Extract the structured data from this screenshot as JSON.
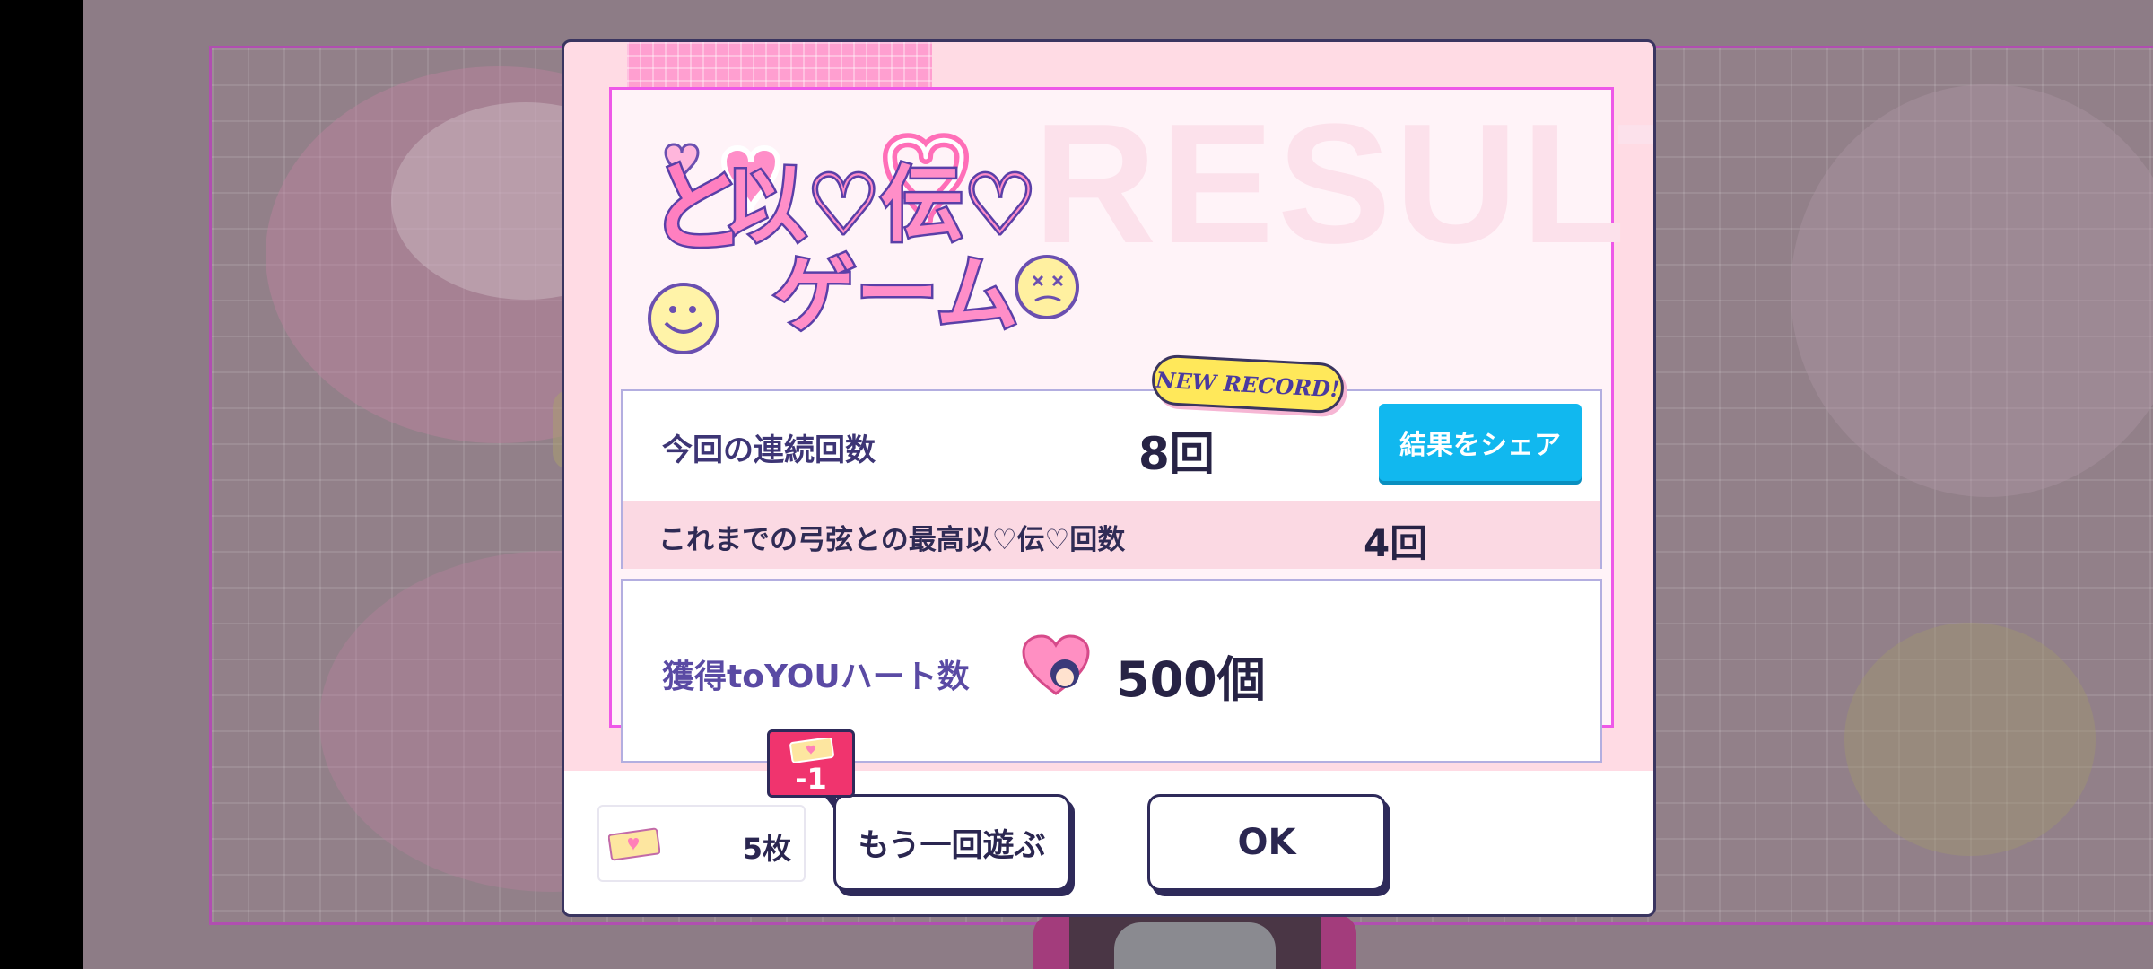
{
  "watermark": "RESULT",
  "logo": {
    "line1": "以♡伝♡",
    "line2": "ゲーム",
    "prefix": "と"
  },
  "new_record_label": "NEW RECORD!",
  "stats": {
    "current_label": "今回の連続回数",
    "current_value": "8回",
    "share_label": "結果をシェア",
    "best_label": "これまでの弓弦との最高以♡伝♡回数",
    "best_value": "4回"
  },
  "hearts": {
    "label": "獲得toYOUハート数",
    "value": "500個"
  },
  "bottom": {
    "ticket_count": "5枚",
    "cost": "-1",
    "play_again_label": "もう一回遊ぶ",
    "ok_label": "OK"
  },
  "colors": {
    "accent_pink": "#ee58e8",
    "share_blue": "#11b8ef",
    "badge_red": "#f0346e",
    "text_navy": "#2a2650"
  }
}
